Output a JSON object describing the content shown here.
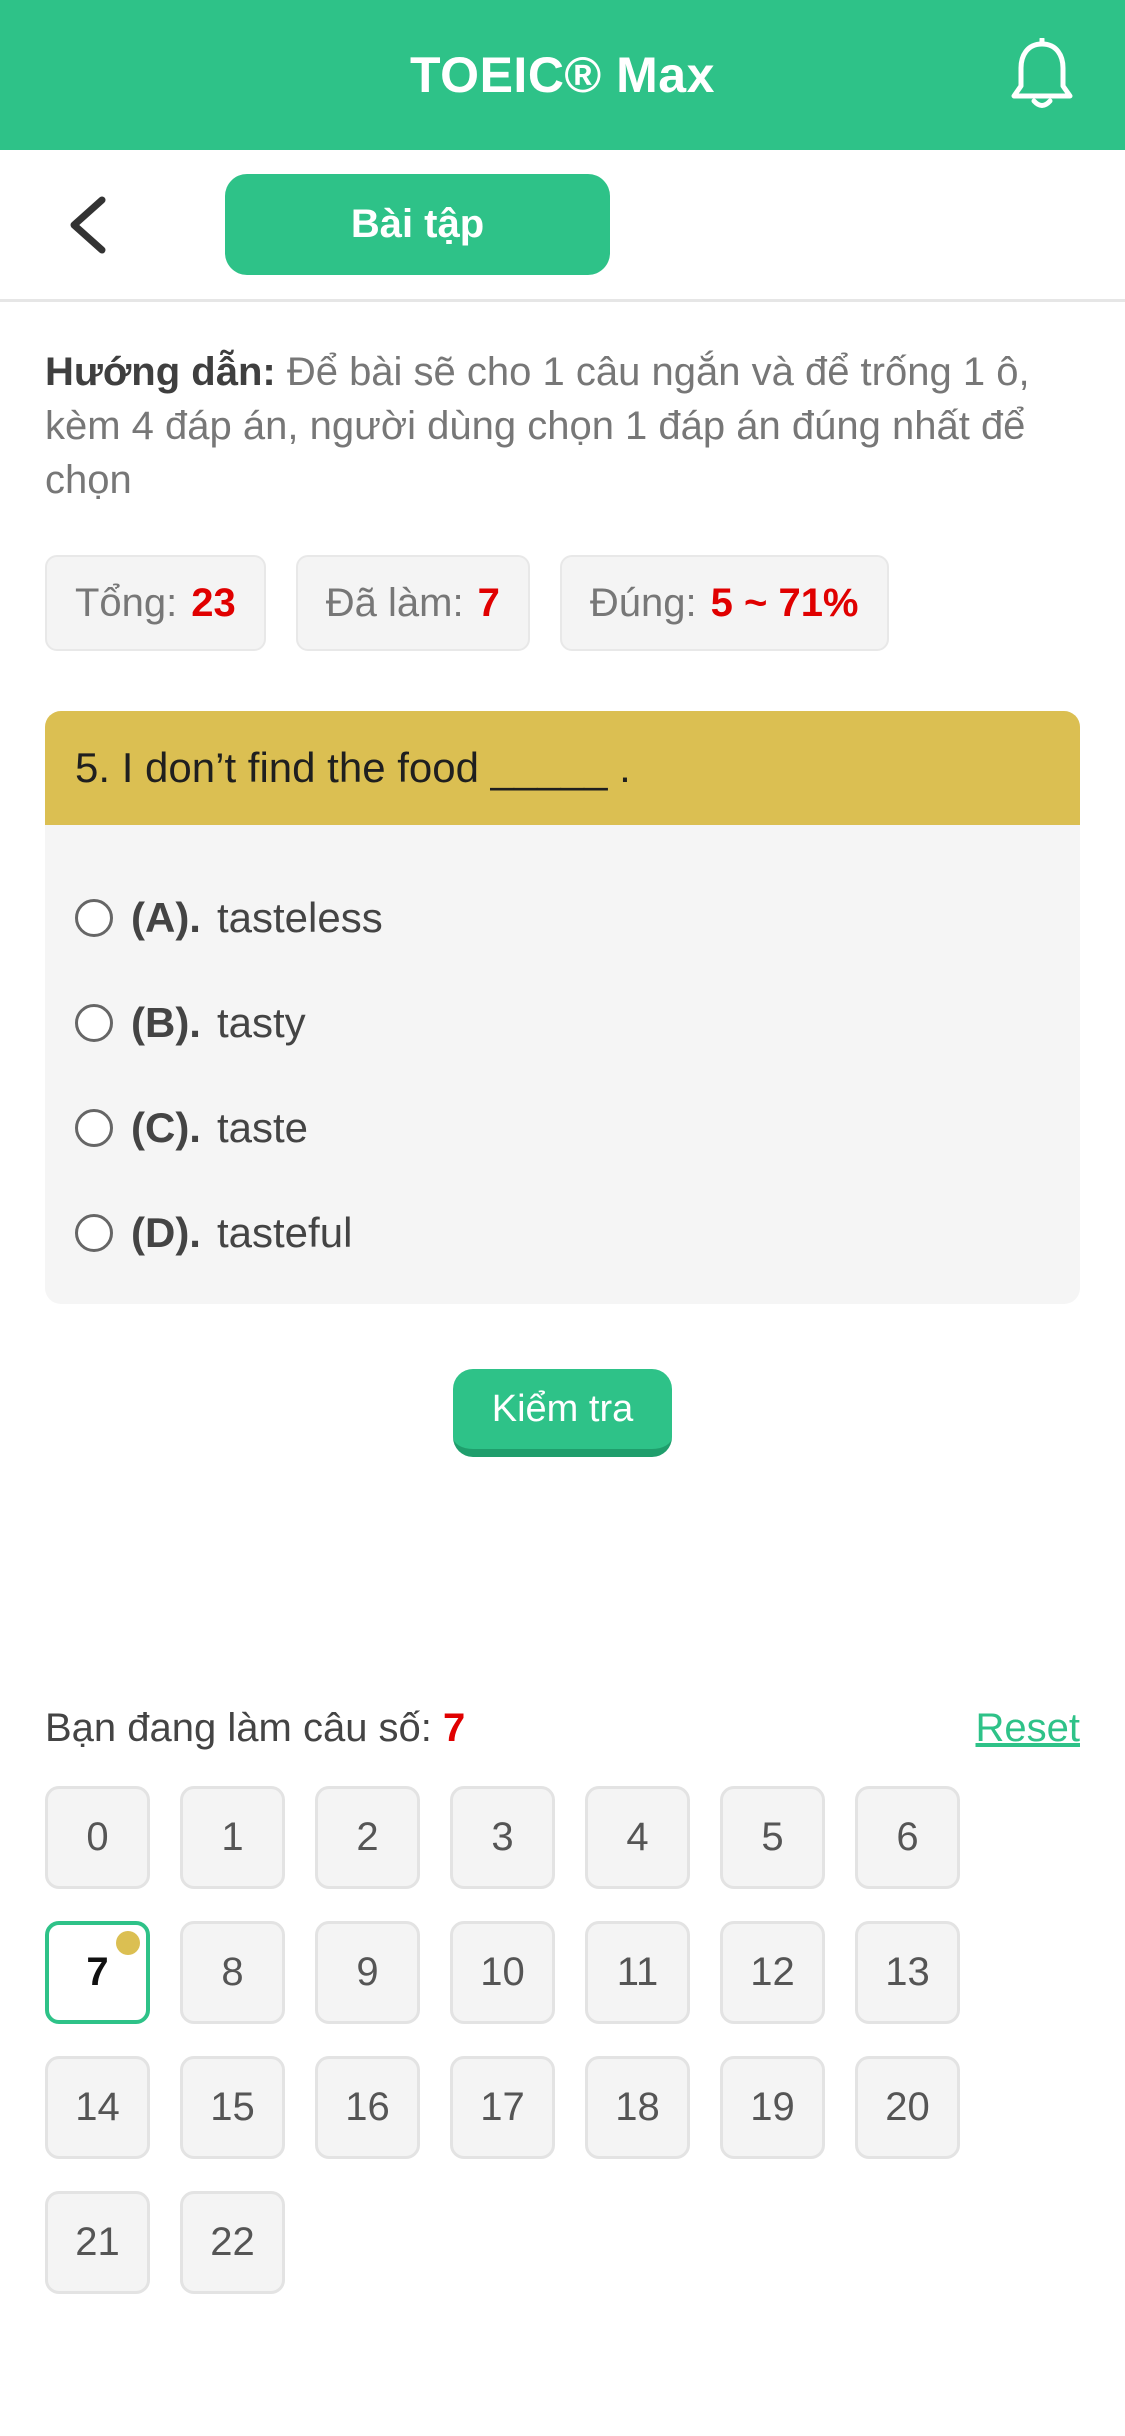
{
  "app": {
    "title": "TOEIC® Max",
    "bell_icon": "bell-icon"
  },
  "nav": {
    "back_icon": "chevron-left-icon",
    "tab_label": "Bài tập"
  },
  "instructions": {
    "label": "Hướng dẫn:",
    "text": " Để bài sẽ cho 1 câu ngắn và để trống 1 ô, kèm 4 đáp án, người dùng chọn 1 đáp án đúng nhất để chọn"
  },
  "stats": {
    "total_label": "Tổng:",
    "total_value": "23",
    "done_label": "Đã làm:",
    "done_value": "7",
    "correct_label": "Đúng:",
    "correct_value": "5 ~ 71%"
  },
  "question": {
    "text": "5. I don’t find the food _____ .",
    "options": [
      {
        "label": "(A).",
        "text": "tasteless"
      },
      {
        "label": "(B).",
        "text": "tasty"
      },
      {
        "label": "(C).",
        "text": "taste"
      },
      {
        "label": "(D).",
        "text": "tasteful"
      }
    ],
    "check_label": "Kiểm tra"
  },
  "progress": {
    "label": "Bạn đang làm câu số:",
    "current": "7",
    "reset_label": "Reset",
    "numbers": [
      "0",
      "1",
      "2",
      "3",
      "4",
      "5",
      "6",
      "7",
      "8",
      "9",
      "10",
      "11",
      "12",
      "13",
      "14",
      "15",
      "16",
      "17",
      "18",
      "19",
      "20",
      "21",
      "22"
    ],
    "active_index": 7
  },
  "colors": {
    "primary": "#2ec288",
    "question_header": "#dbbf52",
    "highlight": "#e00000"
  }
}
